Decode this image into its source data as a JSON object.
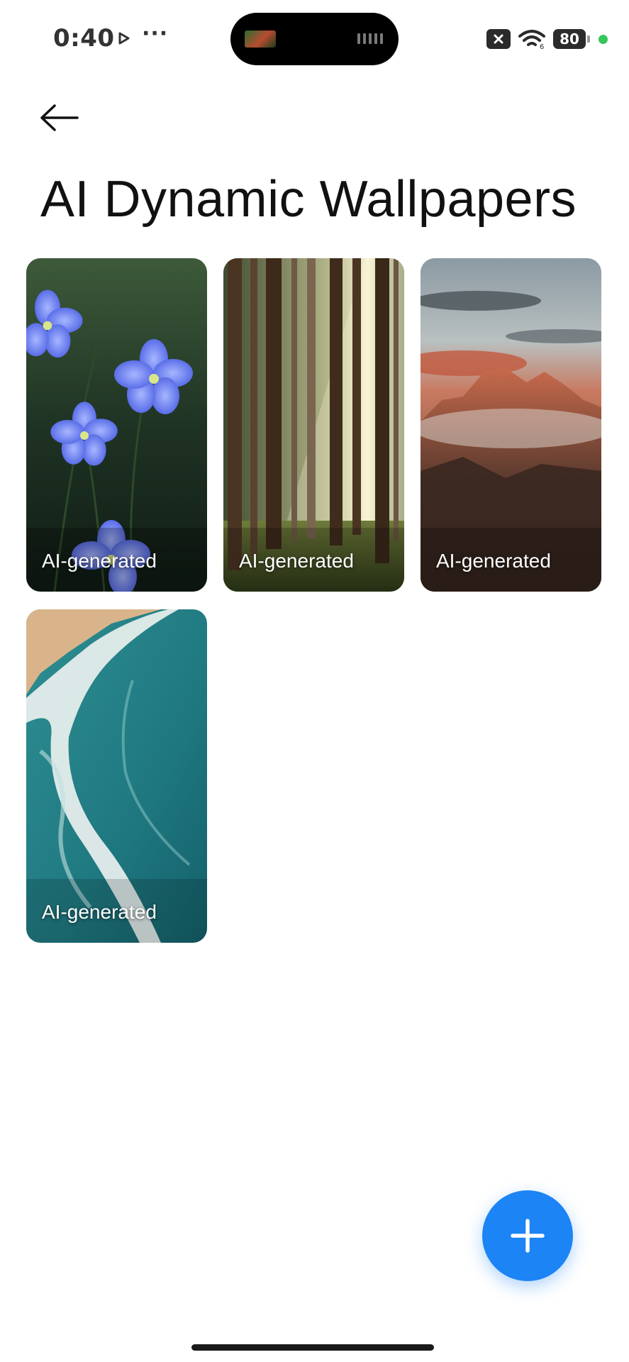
{
  "status_bar": {
    "time": "0:40",
    "battery": "80",
    "icons": [
      "play-icon",
      "more-dots-icon",
      "sim-off-icon",
      "wifi-icon",
      "battery-icon",
      "privacy-dot-icon"
    ]
  },
  "header": {
    "back_icon": "arrow-left-icon",
    "title": "AI Dynamic Wallpapers"
  },
  "wallpapers": [
    {
      "theme": "blue-flowers",
      "label": "AI-generated"
    },
    {
      "theme": "sunlit-forest",
      "label": "AI-generated"
    },
    {
      "theme": "mountain-sunset",
      "label": "AI-generated"
    },
    {
      "theme": "ocean-waves",
      "label": "AI-generated"
    }
  ],
  "fab": {
    "icon": "plus-icon"
  },
  "colors": {
    "accent": "#1c84f4",
    "privacy_dot": "#34c759"
  }
}
